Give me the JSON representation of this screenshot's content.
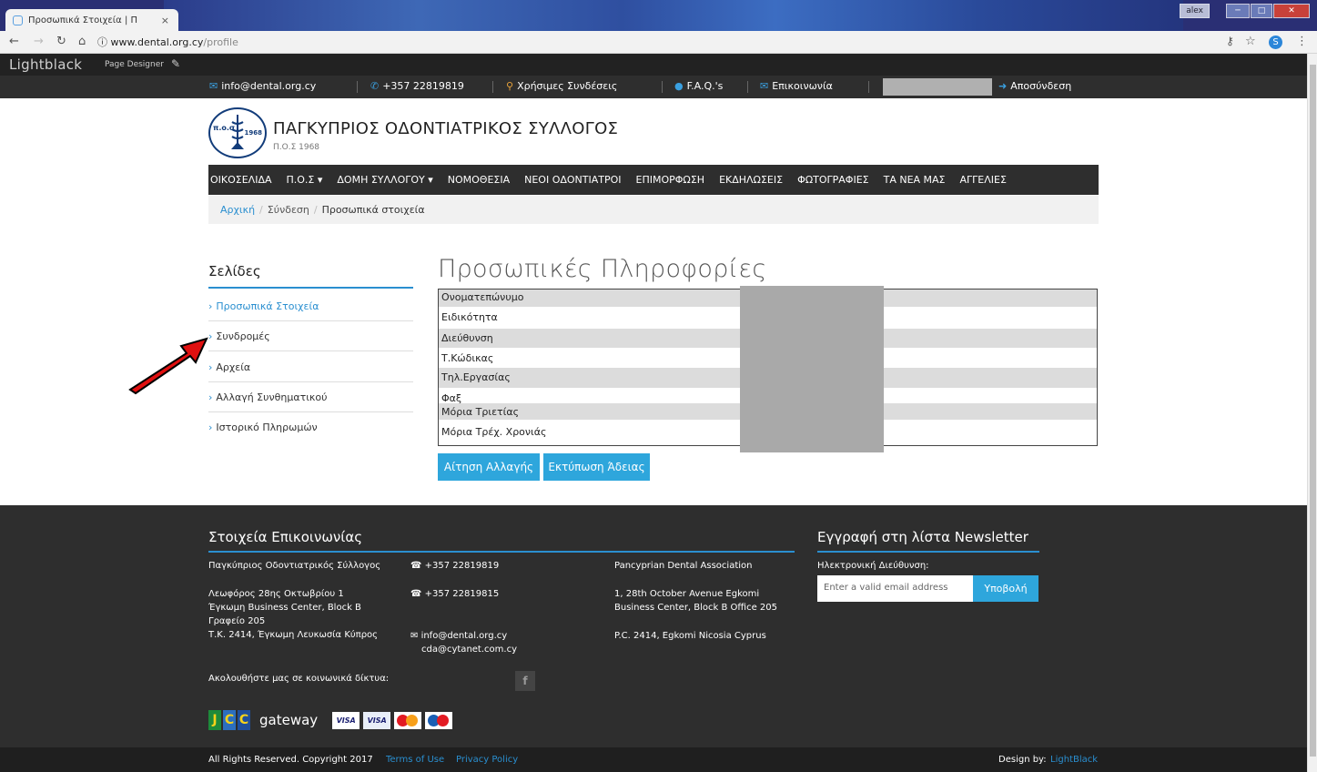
{
  "browser": {
    "tab_title": "Προσωπικά Στοιχεία | Π",
    "tab_close": "×",
    "url_host": "www.dental.org.cy",
    "url_path": "/profile",
    "user_badge": "alex",
    "secure_icon": "ⓘ"
  },
  "lightblack": {
    "logo": "Lightblack",
    "page_designer": "Page Designer"
  },
  "topbar": {
    "email": "info@dental.org.cy",
    "phone": "+357 22819819",
    "links": "Χρήσιμες Συνδέσεις",
    "faq": "F.A.Q.'s",
    "contact": "Επικοινωνία",
    "logout": "Αποσύνδεση"
  },
  "header": {
    "logo_text_left": "π.ο.σ",
    "logo_text_right": "1968",
    "title": "ΠΑΓΚΥΠΡΙΟΣ ΟΔΟΝΤΙΑΤΡΙΚΟΣ ΣΥΛΛΟΓΟΣ",
    "subtitle": "Π.Ο.Σ 1968"
  },
  "nav": [
    {
      "label": "ΟΙΚΟΣΕΛΙΔΑ"
    },
    {
      "label": "Π.Ο.Σ ▾"
    },
    {
      "label": "ΔΟΜΗ ΣΥΛΛΟΓΟΥ ▾"
    },
    {
      "label": "ΝΟΜΟΘΕΣΙΑ"
    },
    {
      "label": "ΝΕΟΙ ΟΔΟΝΤΙΑΤΡΟΙ"
    },
    {
      "label": "ΕΠΙΜΟΡΦΩΣΗ"
    },
    {
      "label": "ΕΚΔΗΛΩΣΕΙΣ"
    },
    {
      "label": "ΦΩΤΟΓΡΑΦΙΕΣ"
    },
    {
      "label": "ΤΑ ΝΕΑ ΜΑΣ"
    },
    {
      "label": "ΑΓΓΕΛΙΕΣ"
    }
  ],
  "breadcrumb": {
    "home": "Αρχική",
    "login": "Σύνδεση",
    "current": "Προσωπικά στοιχεία",
    "sep": "/"
  },
  "sidebar": {
    "title": "Σελίδες",
    "items": [
      {
        "label": "Προσωπικά Στοιχεία"
      },
      {
        "label": "Συνδρομές"
      },
      {
        "label": "Αρχεία"
      },
      {
        "label": "Αλλαγή Συνθηματικού"
      },
      {
        "label": "Ιστορικό Πληρωμών"
      }
    ]
  },
  "main": {
    "title": "Προσωπικές Πληροφορίες",
    "rows": [
      {
        "label": "Ονοματεπώνυμο"
      },
      {
        "label": "Ειδικότητα"
      },
      {
        "label": "Διεύθυνση"
      },
      {
        "label": "Τ.Κώδικας"
      },
      {
        "label": "Τηλ.Εργασίας"
      },
      {
        "label": "Φαξ"
      },
      {
        "label": "Μόρια Τριετίας"
      },
      {
        "label": "Μόρια Τρέχ. Χρονιάς"
      }
    ],
    "btn_request": "Αίτηση Αλλαγής",
    "btn_print": "Εκτύπωση Άδειας"
  },
  "footer": {
    "contact_title": "Στοιχεία Επικοινωνίας",
    "org_gr": "Παγκύπριος Οδοντιατρικός Σύλλογος",
    "addr_gr_1": "Λεωφόρος 28ης Οκτωβρίου 1",
    "addr_gr_2": "Έγκωμη Business Center, Block B",
    "addr_gr_3": "Γραφείο 205",
    "addr_gr_4": "Τ.Κ. 2414, Έγκωμη Λευκωσία Κύπρος",
    "tel": "+357 22819819",
    "fax": "+357 22819815",
    "email_1": "info@dental.org.cy",
    "email_2": "cda@cytanet.com.cy",
    "org_en": "Pancyprian Dental Association",
    "addr_en_1": "1, 28th October Avenue Egkomi",
    "addr_en_2": "Business Center, Block B Office 205",
    "addr_en_3": "P.C. 2414, Egkomi Nicosia Cyprus",
    "social": "Ακολουθήστε μας σε κοινωνικά δίκτυα:",
    "newsletter_title": "Εγγραφή στη λίστα Newsletter",
    "newsletter_label": "Ηλεκτρονική Διεύθυνση:",
    "email_placeholder": "Enter a valid email address",
    "submit": "Υποβολή",
    "gateway": "gateway",
    "copyright": "All Rights Reserved. Copyright 2017",
    "terms": "Terms of Use",
    "privacy": "Privacy Policy",
    "design_by": "Design by:",
    "design_link": "LightBlack"
  }
}
